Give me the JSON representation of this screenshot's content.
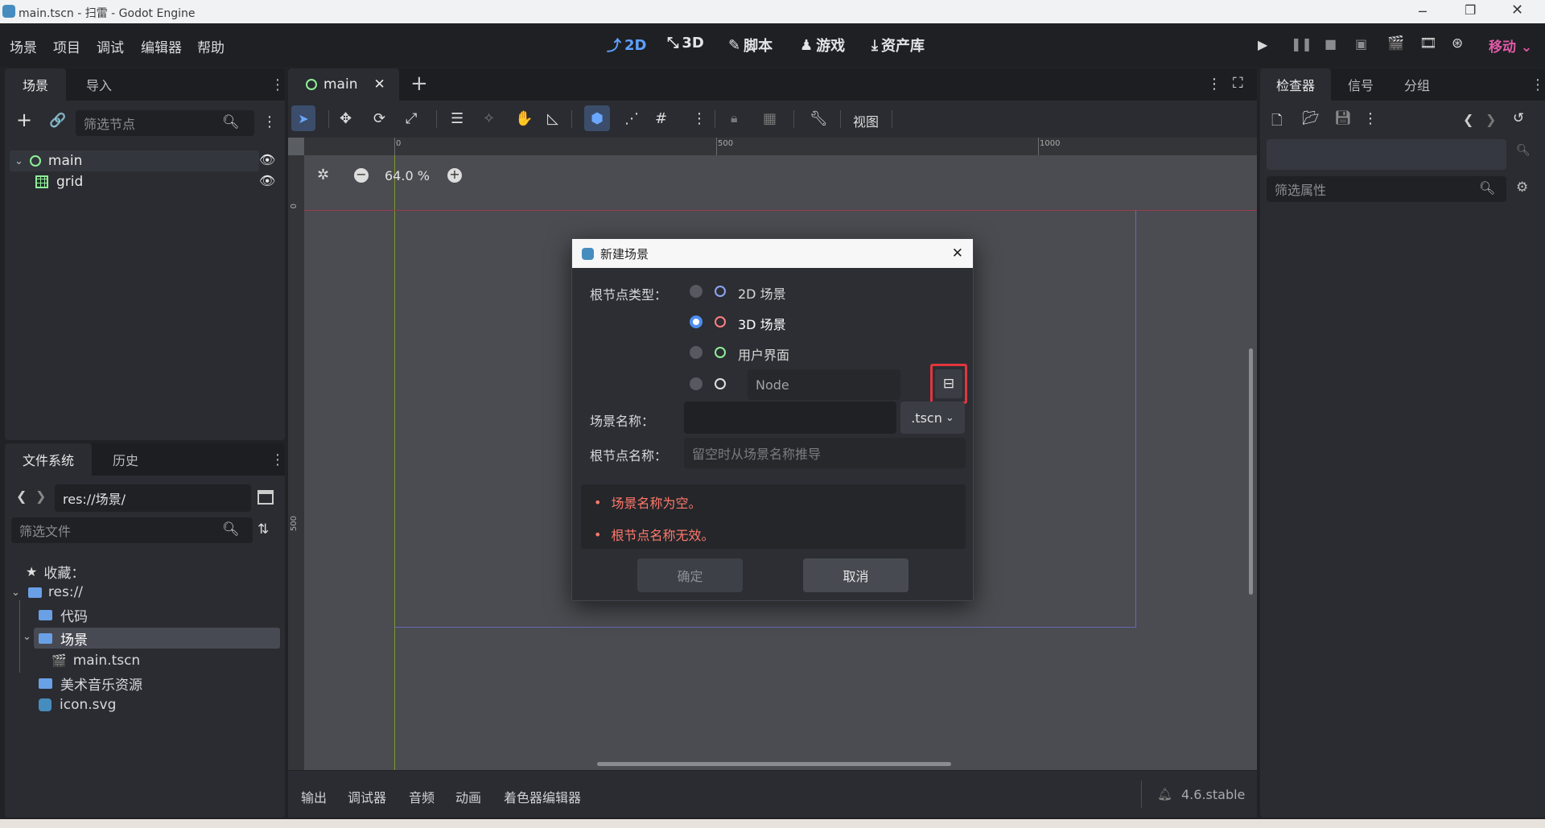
{
  "window": {
    "title": "main.tscn - 扫雷 - Godot Engine"
  },
  "menu": [
    "场景",
    "项目",
    "调试",
    "编辑器",
    "帮助"
  ],
  "modes": {
    "m2d": "2D",
    "m3d": "3D",
    "script": "脚本",
    "game": "游戏",
    "assetlib": "资产库"
  },
  "renderer": "移动",
  "scene_dock": {
    "tabs": {
      "scene": "场景",
      "import": "导入"
    },
    "filter_placeholder": "筛选节点",
    "nodes": [
      {
        "name": "main"
      },
      {
        "name": "grid"
      }
    ]
  },
  "filesystem_dock": {
    "tabs": {
      "fs": "文件系统",
      "history": "历史"
    },
    "path": "res://场景/",
    "filter_placeholder": "筛选文件",
    "items": {
      "favorites": "收藏：",
      "res": "res://",
      "code": "代码",
      "scene": "场景",
      "main_tscn": "main.tscn",
      "art": "美术音乐资源",
      "icon": "icon.svg"
    }
  },
  "editor": {
    "tab": "main",
    "view_menu": "视图",
    "zoom": "64.0 %",
    "ruler": {
      "h": [
        "0",
        "500",
        "1000"
      ],
      "v": [
        "0",
        "500"
      ]
    }
  },
  "bottom_panel": {
    "tabs": [
      "输出",
      "调试器",
      "音频",
      "动画",
      "着色器编辑器"
    ],
    "version": "4.6.stable"
  },
  "inspector": {
    "tabs": {
      "inspector": "检查器",
      "signal": "信号",
      "group": "分组"
    },
    "filter_placeholder": "筛选属性"
  },
  "dialog": {
    "title": "新建场景",
    "root_type_label": "根节点类型：",
    "options": {
      "o2d": "2D 场景",
      "o3d": "3D 场景",
      "oui": "用户界面"
    },
    "custom_node_value": "Node",
    "scene_name_label": "场景名称：",
    "extension": ".tscn",
    "root_name_label": "根节点名称：",
    "root_name_placeholder": "留空时从场景名称推导",
    "errors": [
      "场景名称为空。",
      "根节点名称无效。"
    ],
    "ok": "确定",
    "cancel": "取消"
  },
  "colors": {
    "accent": "#4d8ef0",
    "node2d": "#8da5f3",
    "node3d": "#fc7f7f",
    "control": "#8eef97",
    "error": "#ff786b",
    "highlight": "#e2363f"
  }
}
